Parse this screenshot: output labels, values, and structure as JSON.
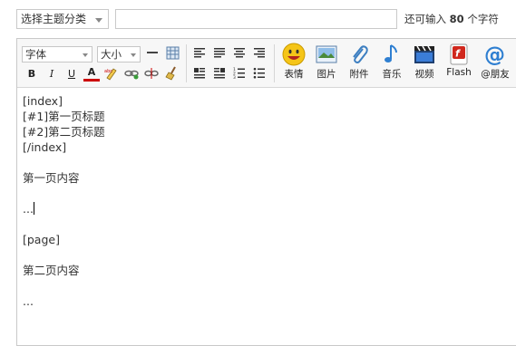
{
  "category_select": {
    "value": "选择主题分类"
  },
  "title_input": {
    "value": ""
  },
  "remaining": {
    "prefix": "还可输入",
    "count": "80",
    "suffix": "个字符"
  },
  "toolbar": {
    "font_select": "字体",
    "size_select": "大小",
    "bold": "B",
    "italic": "I",
    "underline": "U",
    "font_color": "A",
    "big_buttons": {
      "emoticon": "表情",
      "image": "图片",
      "attachment": "附件",
      "music": "音乐",
      "video": "视频",
      "flash": "Flash",
      "mention": "@朋友"
    }
  },
  "editor_lines": [
    "[index]",
    "[#1]第一页标题",
    "[#2]第二页标题",
    "[/index]",
    "",
    "第一页内容",
    "",
    "...",
    "",
    "[page]",
    "",
    "第二页内容",
    "",
    "..."
  ]
}
